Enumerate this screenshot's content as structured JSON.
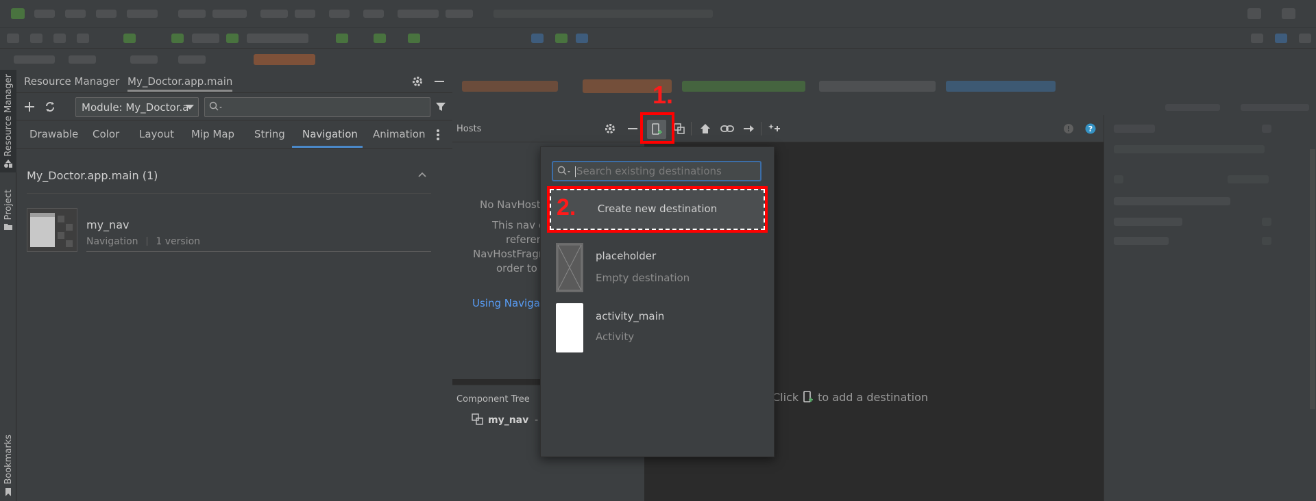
{
  "left_strip": {
    "tabs": [
      "Resource Manager",
      "Project",
      "Bookmarks"
    ]
  },
  "resource_manager": {
    "title": "Resource Manager",
    "tab": "My_Doctor.app.main",
    "module_select": "Module: My_Doctor.a",
    "resource_tabs": [
      "Drawable",
      "Color",
      "Layout",
      "Mip Map",
      "String",
      "Navigation",
      "Animation"
    ],
    "active_tab": "Navigation",
    "section_title": "My_Doctor.app.main (1)",
    "resource": {
      "name": "my_nav",
      "type": "Navigation",
      "versions": "1 version"
    }
  },
  "nav_editor": {
    "hosts_label": "Hosts",
    "hosts_text": [
      "No NavHostl",
      "This nav c",
      "referen",
      "NavHostFragm",
      "order to l"
    ],
    "hosts_link": "Using Navigat",
    "component_tree_label": "Component Tree",
    "component_tree_item": "my_nav",
    "component_tree_suffix": "- r",
    "canvas_hint_before": "Click",
    "canvas_hint_after": "to add a destination"
  },
  "popup": {
    "search_placeholder": "Search existing destinations",
    "create_label": "Create new destination",
    "destinations": [
      {
        "name": "placeholder",
        "type": "Empty destination"
      },
      {
        "name": "activity_main",
        "type": "Activity"
      }
    ]
  },
  "annotations": {
    "step1": "1.",
    "step2": "2."
  },
  "colors": {
    "accent": "#4a88c7",
    "annotation_red": "#ff0000",
    "link": "#589df6"
  }
}
